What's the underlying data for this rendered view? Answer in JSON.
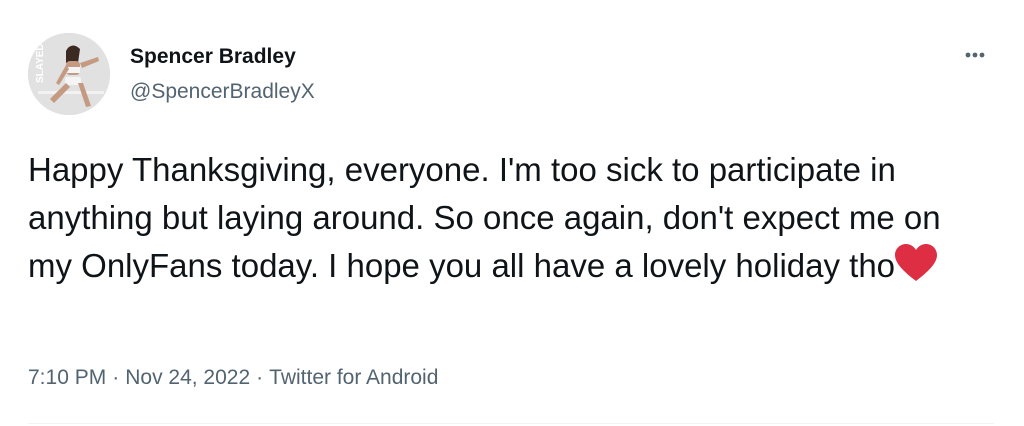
{
  "author": {
    "name": "Spencer Bradley",
    "handle": "@SpencerBradleyX",
    "avatar_badge": "SLAYED"
  },
  "tweet": {
    "text": "Happy Thanksgiving, everyone. I'm too sick to participate in anything but laying around. So once again, don't expect me on my OnlyFans today. I hope you all have a lovely holiday tho",
    "emoji": "red-heart-icon"
  },
  "meta": {
    "time": "7:10 PM",
    "date": "Nov 24, 2022",
    "source": "Twitter for Android",
    "separator": "·"
  },
  "colors": {
    "text": "#0f1419",
    "secondary": "#536471",
    "heart": "#dd2e44",
    "divider": "#eff3f4"
  },
  "icons": {
    "more": "more-horizontal-icon"
  }
}
